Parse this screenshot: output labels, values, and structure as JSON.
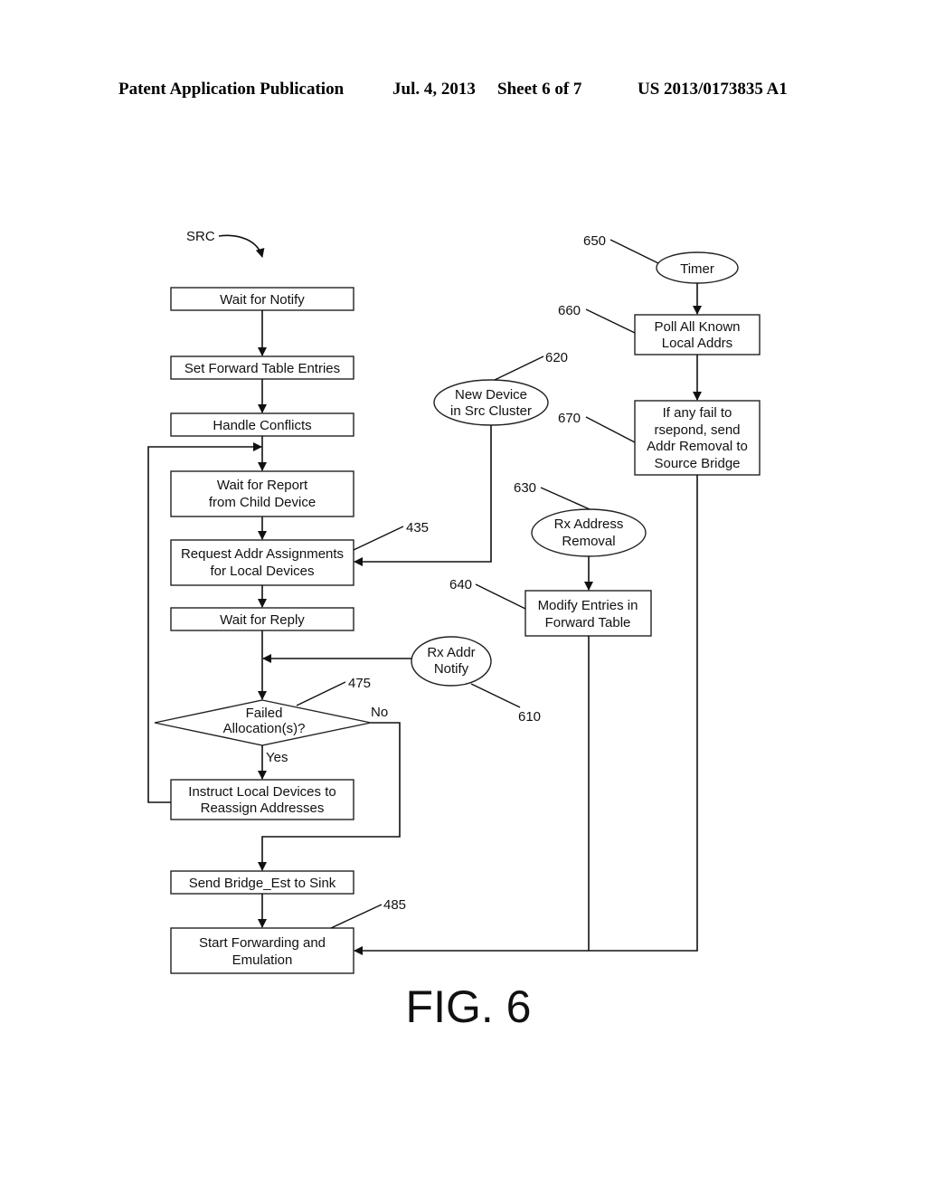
{
  "header": {
    "publication": "Patent Application Publication",
    "date": "Jul. 4, 2013",
    "sheet": "Sheet 6 of 7",
    "number": "US 2013/0173835 A1"
  },
  "figure": {
    "label": "FIG. 6",
    "start_label": "SRC",
    "left_flow": {
      "wait_notify": "Wait for Notify",
      "set_forward": "Set Forward Table Entries",
      "handle_conflicts": "Handle Conflicts",
      "wait_report": [
        "Wait for Report",
        "from Child Device"
      ],
      "request_addr": [
        "Request Addr Assignments",
        "for Local Devices"
      ],
      "request_addr_ref": "435",
      "wait_reply": "Wait for Reply",
      "decision": [
        "Failed",
        "Allocation(s)?"
      ],
      "decision_ref": "475",
      "decision_yes": "Yes",
      "decision_no": "No",
      "instruct": [
        "Instruct Local Devices to",
        "Reassign Addresses"
      ],
      "send_bridge": "Send Bridge_Est to Sink",
      "start_forwarding": [
        "Start Forwarding and",
        "Emulation"
      ],
      "start_forwarding_ref": "485"
    },
    "events": {
      "rx_addr_notify": [
        "Rx Addr",
        "Notify"
      ],
      "rx_addr_notify_ref": "610",
      "new_device": [
        "New Device",
        "in Src Cluster"
      ],
      "new_device_ref": "620",
      "rx_addr_removal": [
        "Rx Address",
        "Removal"
      ],
      "rx_addr_removal_ref": "630",
      "modify_entries": [
        "Modify Entries in",
        "Forward Table"
      ],
      "modify_entries_ref": "640",
      "timer": "Timer",
      "timer_ref": "650",
      "poll": [
        "Poll All Known",
        "Local Addrs"
      ],
      "poll_ref": "660",
      "fail_respond": [
        "If any fail to",
        "rsepond, send",
        "Addr Removal to",
        "Source Bridge"
      ],
      "fail_respond_ref": "670"
    }
  }
}
